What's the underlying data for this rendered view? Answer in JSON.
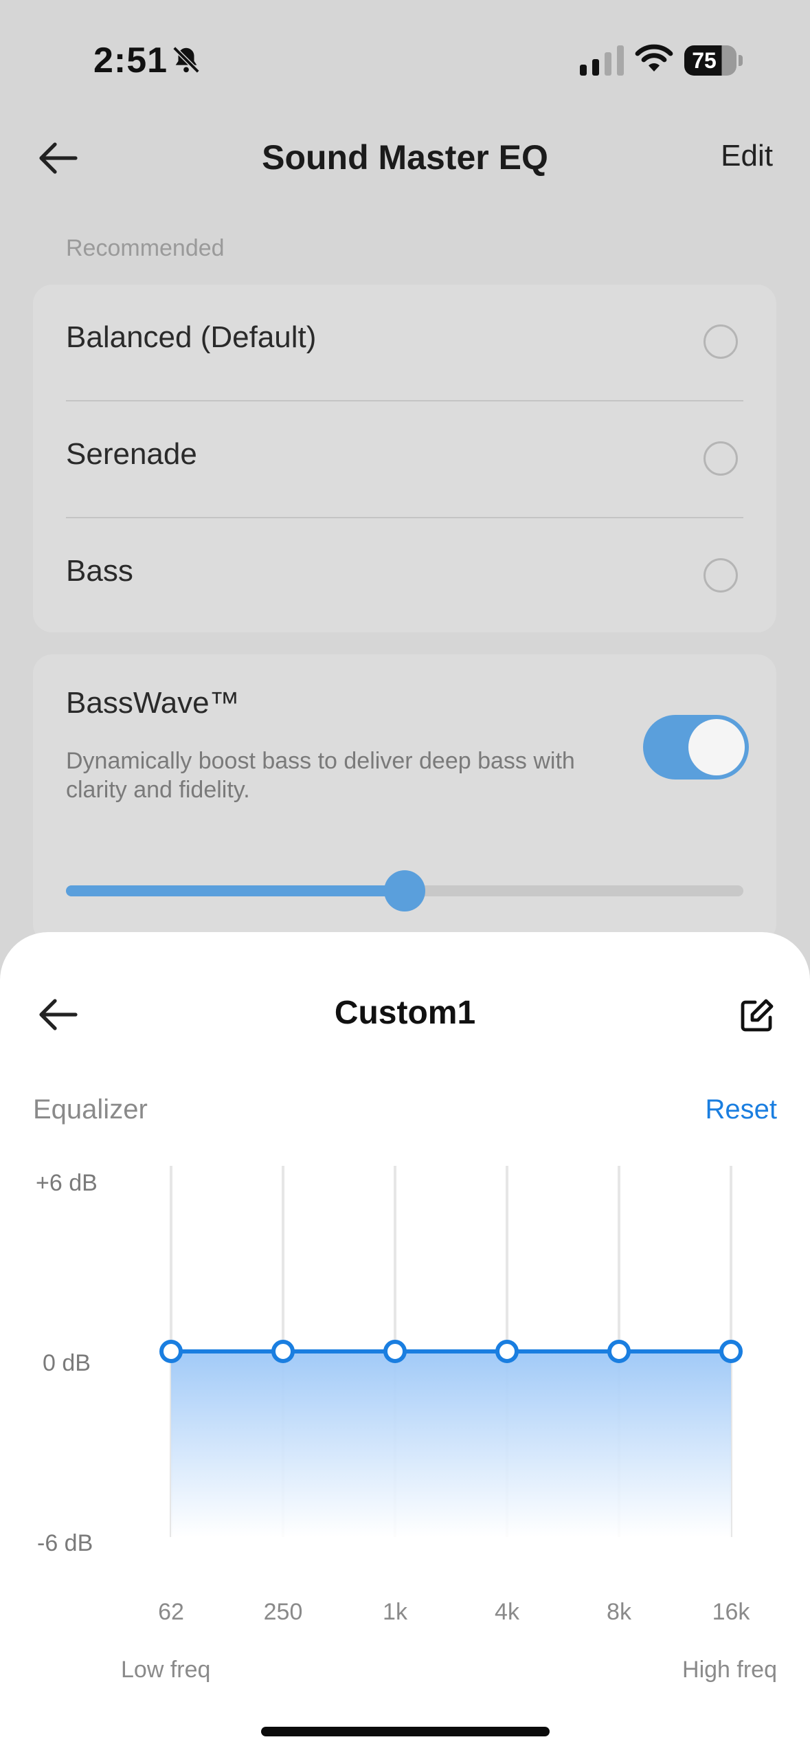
{
  "status_bar": {
    "time": "2:51",
    "battery": "75"
  },
  "header": {
    "title": "Sound Master EQ",
    "edit_label": "Edit"
  },
  "recommended": {
    "label": "Recommended",
    "presets": [
      {
        "name": "Balanced (Default)"
      },
      {
        "name": "Serenade"
      },
      {
        "name": "Bass"
      }
    ]
  },
  "basswave": {
    "title": "BassWave™",
    "description": "Dynamically boost bass to deliver deep bass with clarity and fidelity.",
    "enabled": true,
    "level": 0.5
  },
  "sheet": {
    "title": "Custom1",
    "equalizer_label": "Equalizer",
    "reset_label": "Reset",
    "low_freq_label": "Low freq",
    "high_freq_label": "High freq"
  },
  "colors": {
    "accent": "#1a7ee0",
    "toggle_on": "#5a9fdc"
  },
  "chart_data": {
    "type": "line",
    "x": [
      "62",
      "250",
      "1k",
      "4k",
      "8k",
      "16k"
    ],
    "y_ticks": [
      "+6 dB",
      "0 dB",
      "-6 dB"
    ],
    "ylim": [
      -6,
      6
    ],
    "series": [
      {
        "values": [
          0,
          0,
          0,
          0,
          0,
          0
        ]
      }
    ],
    "grid": true
  }
}
